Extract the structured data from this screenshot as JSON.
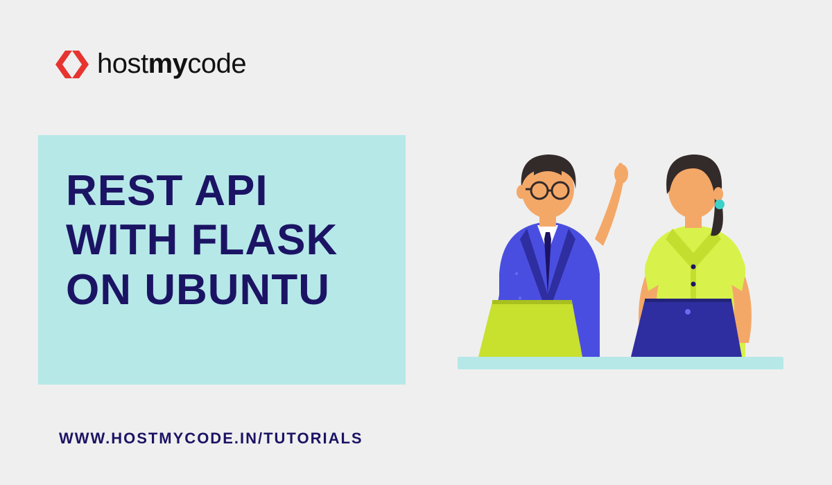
{
  "logo": {
    "host": "host",
    "my": "my",
    "code": "code"
  },
  "title": "REST API WITH FLASK ON UBUNTU",
  "url": "WWW.HOSTMYCODE.IN/TUTORIALS",
  "colors": {
    "bg": "#efefef",
    "panel": "#b6e8e8",
    "accent": "#1b1464",
    "logoRed": "#e73430"
  },
  "illustration": {
    "description": "Two people at a desk with laptops",
    "person_left": {
      "shirt": "#4a4ee0",
      "vest": "#2e2ea0",
      "tie": "#1b1464",
      "skin": "#f4a868",
      "hair": "#332a2a"
    },
    "person_right": {
      "shirt": "#d8f24b",
      "skin": "#f4a868",
      "hair": "#332a2a",
      "earring": "#3bd1c9"
    },
    "laptop_left": "#c8e02e",
    "laptop_right": "#2e2ea0",
    "desk": "#b6e8e8"
  }
}
